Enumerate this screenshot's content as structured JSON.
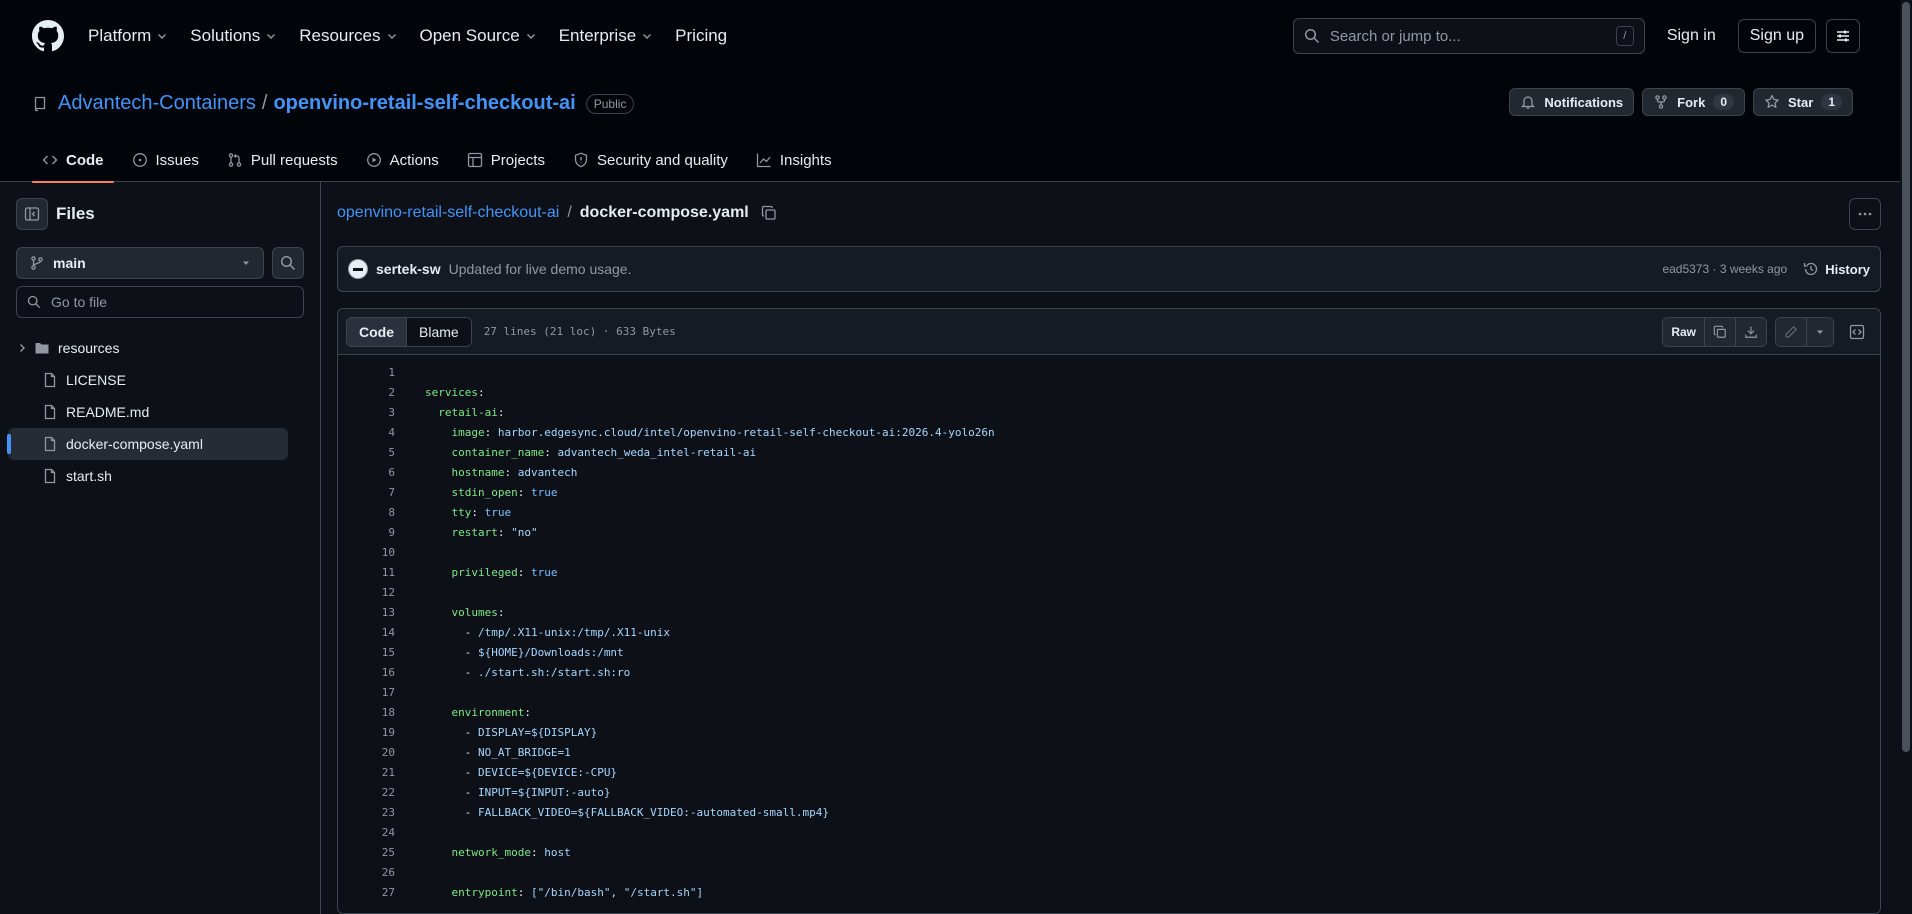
{
  "header": {
    "nav": [
      "Platform",
      "Solutions",
      "Resources",
      "Open Source",
      "Enterprise",
      "Pricing"
    ],
    "search_placeholder": "Search or jump to...",
    "search_kbd": "/",
    "signin": "Sign in",
    "signup": "Sign up"
  },
  "repo": {
    "owner": "Advantech-Containers",
    "sep": "/",
    "name": "openvino-retail-self-checkout-ai",
    "visibility": "Public",
    "notifications": "Notifications",
    "fork": "Fork",
    "fork_count": "0",
    "star": "Star",
    "star_count": "1"
  },
  "tabs": [
    "Code",
    "Issues",
    "Pull requests",
    "Actions",
    "Projects",
    "Security and quality",
    "Insights"
  ],
  "sidebar": {
    "title": "Files",
    "branch": "main",
    "goto_placeholder": "Go to file",
    "tree": [
      {
        "name": "resources",
        "type": "folder"
      },
      {
        "name": "LICENSE",
        "type": "file"
      },
      {
        "name": "README.md",
        "type": "file"
      },
      {
        "name": "docker-compose.yaml",
        "type": "file",
        "selected": true
      },
      {
        "name": "start.sh",
        "type": "file"
      }
    ]
  },
  "breadcrumb": {
    "root": "openvino-retail-self-checkout-ai",
    "sep": "/",
    "file": "docker-compose.yaml"
  },
  "commit": {
    "author": "sertek-sw",
    "message": "Updated for live demo usage.",
    "meta": "ead5373 · 3 weeks ago",
    "history": "History"
  },
  "fileview": {
    "tab_code": "Code",
    "tab_blame": "Blame",
    "meta": "27 lines (21 loc) · 633 Bytes",
    "raw": "Raw"
  },
  "code_lines": [
    [],
    [
      [
        "k",
        "services"
      ],
      [
        "t",
        ":"
      ]
    ],
    [
      [
        "t",
        "  "
      ],
      [
        "k",
        "retail-ai"
      ],
      [
        "t",
        ":"
      ]
    ],
    [
      [
        "t",
        "    "
      ],
      [
        "k",
        "image"
      ],
      [
        "t",
        ": "
      ],
      [
        "s",
        "harbor.edgesync.cloud/intel/openvino-retail-self-checkout-ai:2026.4-yolo26n"
      ]
    ],
    [
      [
        "t",
        "    "
      ],
      [
        "k",
        "container_name"
      ],
      [
        "t",
        ": "
      ],
      [
        "s",
        "advantech_weda_intel-retail-ai"
      ]
    ],
    [
      [
        "t",
        "    "
      ],
      [
        "k",
        "hostname"
      ],
      [
        "t",
        ": "
      ],
      [
        "s",
        "advantech"
      ]
    ],
    [
      [
        "t",
        "    "
      ],
      [
        "k",
        "stdin_open"
      ],
      [
        "t",
        ": "
      ],
      [
        "b",
        "true"
      ]
    ],
    [
      [
        "t",
        "    "
      ],
      [
        "k",
        "tty"
      ],
      [
        "t",
        ": "
      ],
      [
        "b",
        "true"
      ]
    ],
    [
      [
        "t",
        "    "
      ],
      [
        "k",
        "restart"
      ],
      [
        "t",
        ": "
      ],
      [
        "s",
        "\"no\""
      ]
    ],
    [],
    [
      [
        "t",
        "    "
      ],
      [
        "k",
        "privileged"
      ],
      [
        "t",
        ": "
      ],
      [
        "b",
        "true"
      ]
    ],
    [],
    [
      [
        "t",
        "    "
      ],
      [
        "k",
        "volumes"
      ],
      [
        "t",
        ":"
      ]
    ],
    [
      [
        "t",
        "      - "
      ],
      [
        "s",
        "/tmp/.X11-unix:/tmp/.X11-unix"
      ]
    ],
    [
      [
        "t",
        "      - "
      ],
      [
        "s",
        "${HOME}/Downloads:/mnt"
      ]
    ],
    [
      [
        "t",
        "      - "
      ],
      [
        "s",
        "./start.sh:/start.sh:ro"
      ]
    ],
    [],
    [
      [
        "t",
        "    "
      ],
      [
        "k",
        "environment"
      ],
      [
        "t",
        ":"
      ]
    ],
    [
      [
        "t",
        "      - "
      ],
      [
        "s",
        "DISPLAY=${DISPLAY}"
      ]
    ],
    [
      [
        "t",
        "      - "
      ],
      [
        "s",
        "NO_AT_BRIDGE=1"
      ]
    ],
    [
      [
        "t",
        "      - "
      ],
      [
        "s",
        "DEVICE=${DEVICE:-CPU}"
      ]
    ],
    [
      [
        "t",
        "      - "
      ],
      [
        "s",
        "INPUT=${INPUT:-auto}"
      ]
    ],
    [
      [
        "t",
        "      - "
      ],
      [
        "s",
        "FALLBACK_VIDEO=${FALLBACK_VIDEO:-automated-small.mp4}"
      ]
    ],
    [],
    [
      [
        "t",
        "    "
      ],
      [
        "k",
        "network_mode"
      ],
      [
        "t",
        ": "
      ],
      [
        "s",
        "host"
      ]
    ],
    [],
    [
      [
        "t",
        "    "
      ],
      [
        "k",
        "entrypoint"
      ],
      [
        "t",
        ": "
      ],
      [
        "s",
        "[\"/bin/bash\", \"/start.sh\"]"
      ]
    ]
  ]
}
